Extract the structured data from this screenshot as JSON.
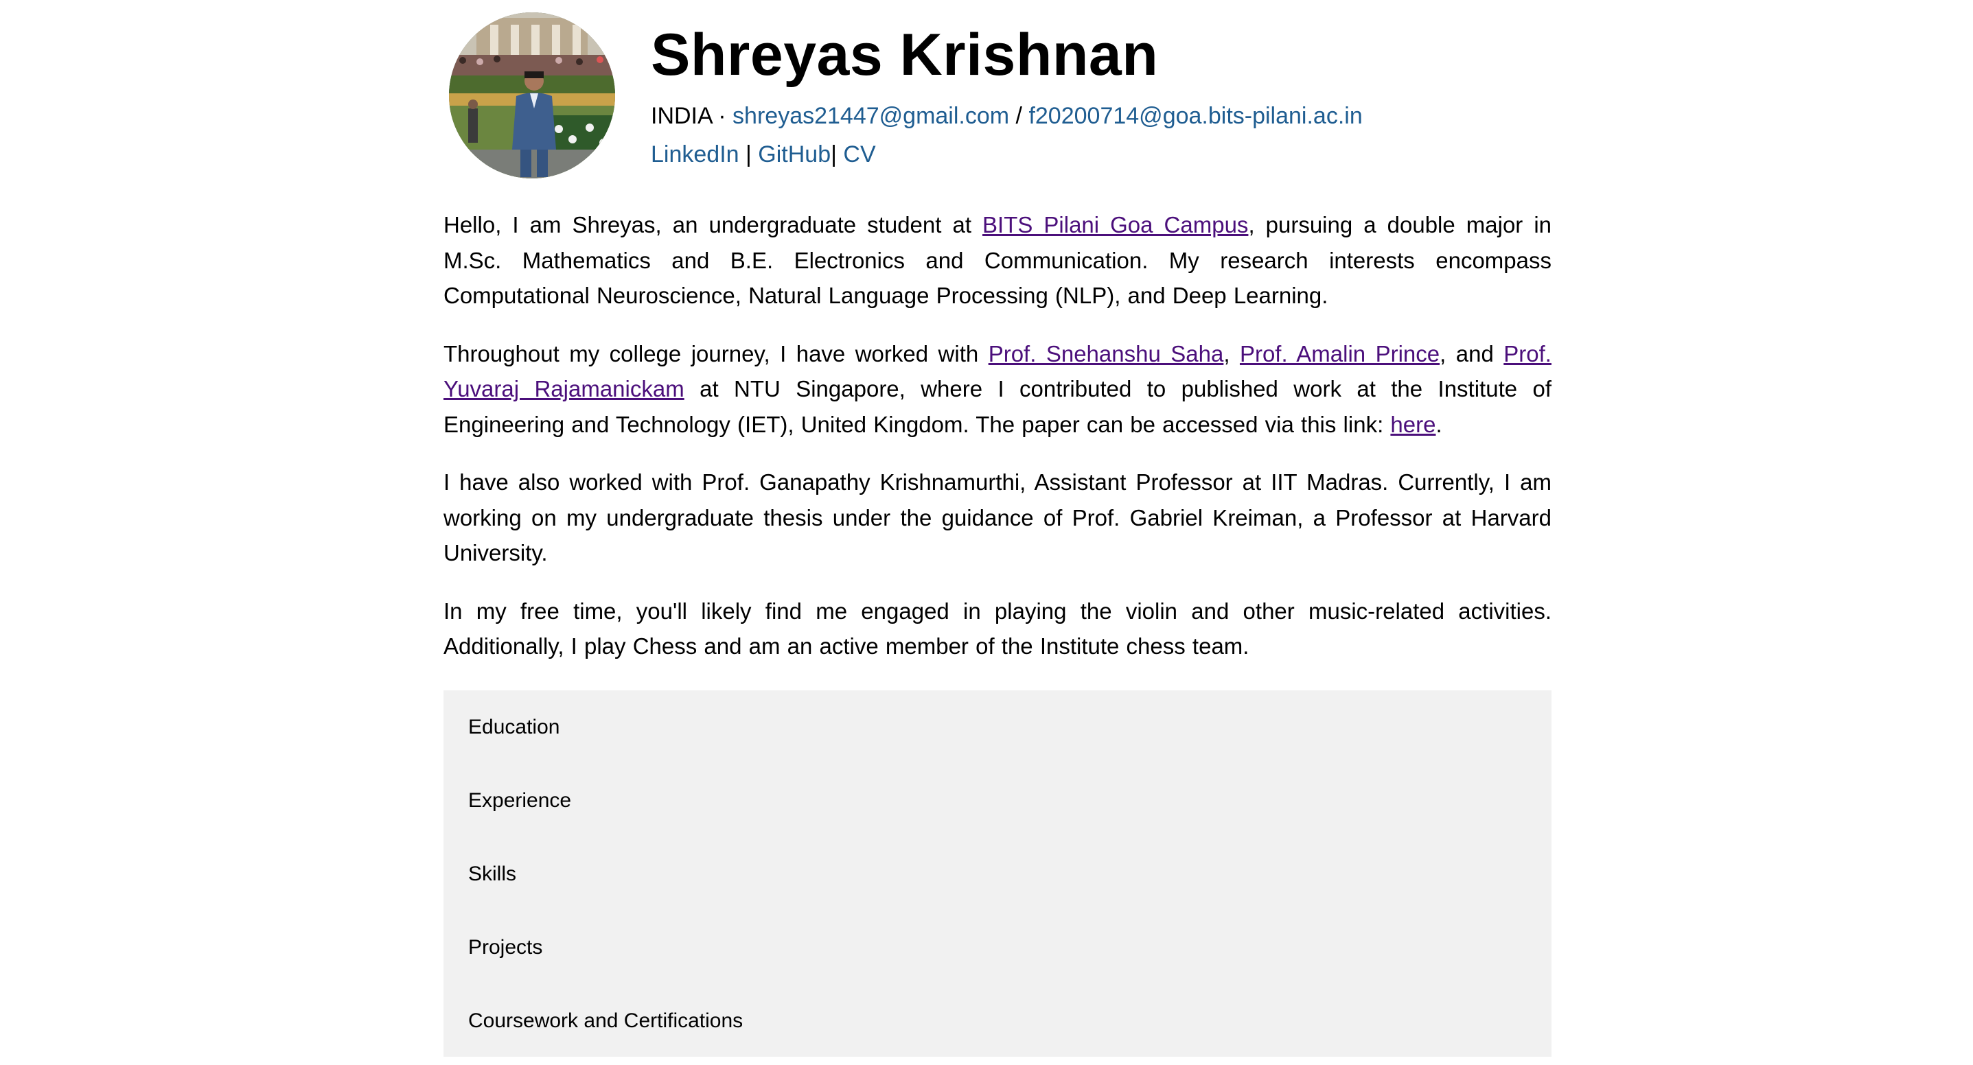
{
  "profile": {
    "name": "Shreyas Krishnan",
    "country": "INDIA",
    "separator": "·",
    "email_primary": "shreyas21447@gmail.com",
    "email_slash": "/",
    "email_secondary": "f20200714@goa.bits-pilani.ac.in",
    "link_linkedin": "LinkedIn",
    "link_github": "GitHub",
    "link_cv": "CV",
    "pipe": "|",
    "avatar_alt_icon": "profile-photo"
  },
  "about": {
    "p1_a": "Hello, I am Shreyas, an undergraduate student at ",
    "p1_link": "BITS Pilani Goa Campus",
    "p1_b": ", pursuing a double major in M.Sc. Mathematics and B.E. Electronics and Communication. My research interests encompass Computational Neuroscience, Natural Language Processing (NLP), and Deep Learning.",
    "p2_a": "Throughout my college journey, I have worked with ",
    "p2_link1": "Prof. Snehanshu Saha",
    "p2_b": ", ",
    "p2_link2": "Prof. Amalin Prince",
    "p2_c": ", and ",
    "p2_link3": "Prof. Yuvaraj Rajamanickam",
    "p2_d": " at NTU Singapore, where I contributed to published work at the Institute of Engineering and Technology (IET), United Kingdom. The paper can be accessed via this link: ",
    "p2_link4": "here",
    "p2_e": ".",
    "p3": "I have also worked with Prof. Ganapathy Krishnamurthi, Assistant Professor at IIT Madras. Currently, I am working on my undergraduate thesis under the guidance of Prof. Gabriel Kreiman, a Professor at Harvard University.",
    "p4": "In my free time, you'll likely find me engaged in playing the violin and other music-related activities. Additionally, I play Chess and am an active member of the Institute chess team."
  },
  "sections": [
    {
      "label": "Education"
    },
    {
      "label": "Experience"
    },
    {
      "label": "Skills"
    },
    {
      "label": "Projects"
    },
    {
      "label": "Coursework and Certifications"
    }
  ],
  "colors": {
    "header_link": "#1f5d91",
    "body_link": "#4b0f7b",
    "accordion_bg": "#f1f1f1"
  }
}
